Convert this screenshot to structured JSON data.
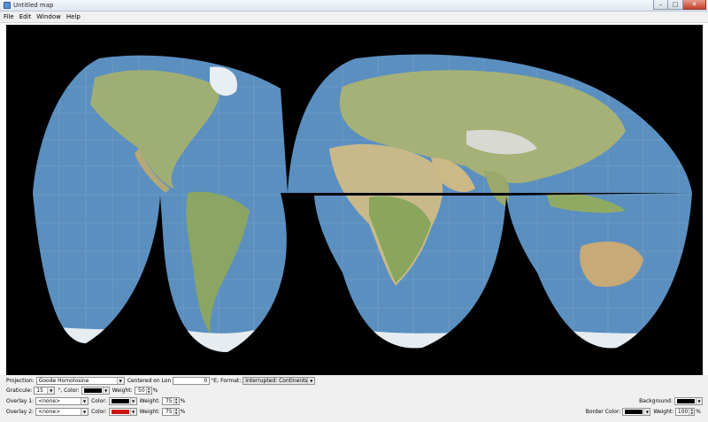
{
  "window": {
    "title": "Untitled map"
  },
  "menu": [
    "File",
    "Edit",
    "Window",
    "Help"
  ],
  "colors": {
    "map_background": "#000000",
    "ocean": "#5b8fc0",
    "land": "#a7b77a",
    "graticule": "#8fb0d0",
    "overlay1": "#000000",
    "overlay2": "#cc1111",
    "border": "#000000",
    "background": "#000000"
  },
  "controls": {
    "projection_label": "Projection:",
    "projection_value": "Goode Homolosine",
    "centered_label": "Centered on Lon",
    "centered_value": "0",
    "centered_unit": "°E;",
    "format_label": "Format:",
    "format_value": "Interrupted: Continents",
    "graticule_label": "Graticule:",
    "graticule_value": "15",
    "graticule_unit": "°, Color:",
    "graticule_weight_label": "Weight:",
    "graticule_weight_value": "50",
    "percent": "%",
    "overlay1_label": "Overlay 1:",
    "overlay1_value": "<none>",
    "overlay2_label": "Overlay 2:",
    "overlay2_value": "<none>",
    "color_label": "Color:",
    "weight_label": "Weight:",
    "overlay1_weight": "75",
    "overlay2_weight": "75",
    "background_label": "Background:",
    "border_color_label": "Border Color:",
    "border_weight_value": "100"
  }
}
